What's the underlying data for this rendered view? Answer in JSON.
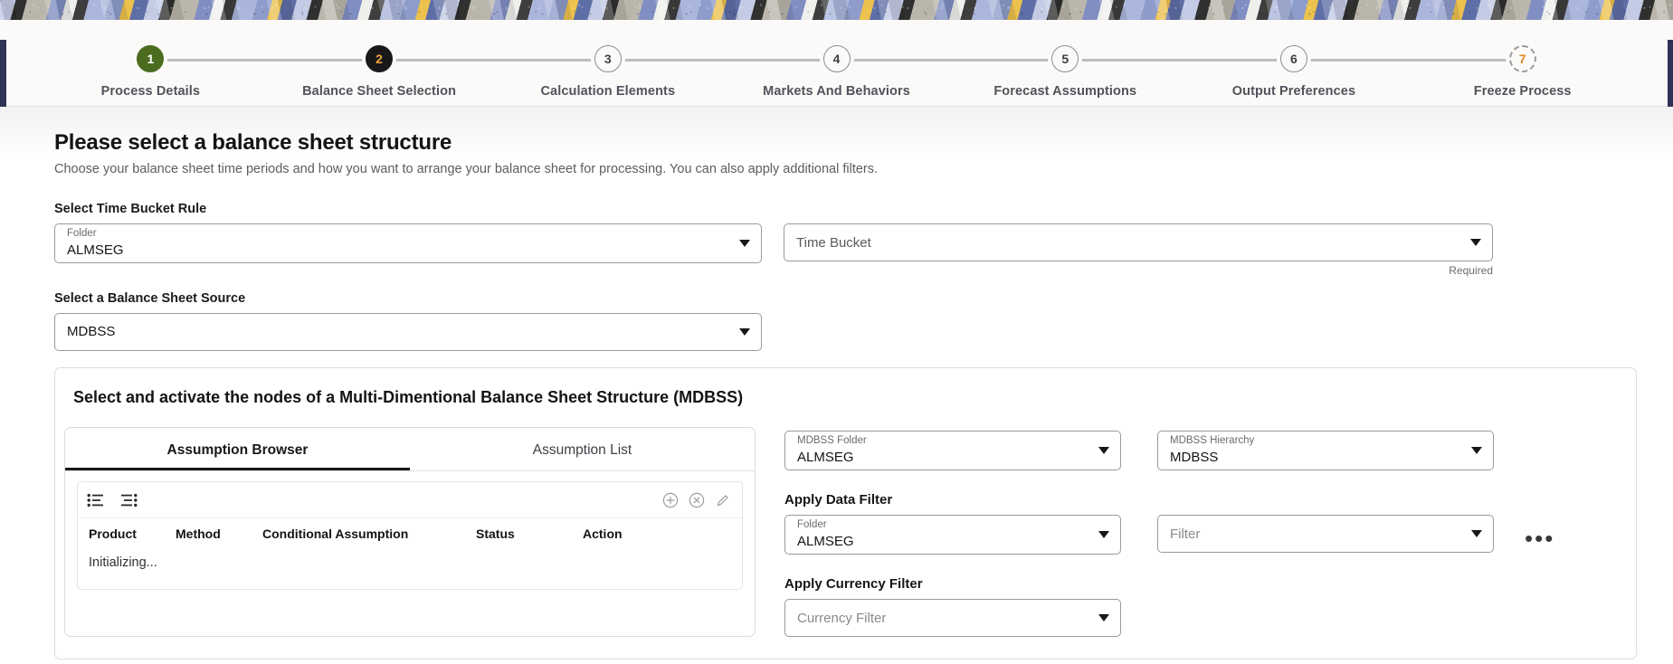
{
  "banner": {
    "name": "decorative-header-image"
  },
  "stepper": {
    "steps": [
      {
        "num": "1",
        "label": "Process Details",
        "state": "done"
      },
      {
        "num": "2",
        "label": "Balance Sheet Selection",
        "state": "active"
      },
      {
        "num": "3",
        "label": "Calculation Elements",
        "state": "todo"
      },
      {
        "num": "4",
        "label": "Markets And Behaviors",
        "state": "todo"
      },
      {
        "num": "5",
        "label": "Forecast Assumptions",
        "state": "todo"
      },
      {
        "num": "6",
        "label": "Output Preferences",
        "state": "todo"
      },
      {
        "num": "7",
        "label": "Freeze Process",
        "state": "pending"
      }
    ]
  },
  "page": {
    "title": "Please select a balance sheet structure",
    "subtitle": "Choose your balance sheet time periods and how you want to arrange your balance sheet for processing. You can also apply additional filters."
  },
  "time_bucket": {
    "section_label": "Select Time Bucket Rule",
    "folder": {
      "label": "Folder",
      "value": "ALMSEG"
    },
    "bucket": {
      "placeholder": "Time Bucket",
      "value": ""
    },
    "required_note": "Required"
  },
  "balance_source": {
    "section_label": "Select a Balance Sheet Source",
    "value": "MDBSS"
  },
  "mdbss": {
    "title": "Select and activate the nodes of a Multi-Dimentional Balance Sheet Structure (MDBSS)",
    "tabs": [
      {
        "label": "Assumption Browser",
        "active": true
      },
      {
        "label": "Assumption List",
        "active": false
      }
    ],
    "toolbar": {
      "list_left_icon": "list-bullets-left-icon",
      "list_right_icon": "list-bullets-right-icon",
      "add_icon": "plus-circle-icon",
      "remove_icon": "close-circle-icon",
      "edit_icon": "pencil-icon"
    },
    "grid": {
      "columns": [
        "Product",
        "Method",
        "Conditional Assumption",
        "Status",
        "Action"
      ],
      "status_text": "Initializing..."
    },
    "folder": {
      "label": "MDBSS Folder",
      "value": "ALMSEG"
    },
    "hierarchy": {
      "label": "MDBSS Hierarchy",
      "value": "MDBSS"
    },
    "data_filter": {
      "block_label": "Apply Data Filter",
      "folder": {
        "label": "Folder",
        "value": "ALMSEG"
      },
      "filter": {
        "placeholder": "Filter",
        "value": ""
      },
      "more_icon": "more-horizontal-icon"
    },
    "currency_filter": {
      "block_label": "Apply Currency Filter",
      "placeholder": "Currency Filter",
      "value": ""
    }
  },
  "colors": {
    "step_done": "#4b6b1f",
    "step_active_bg": "#18181b",
    "step_active_num": "#f0a93b",
    "step_pending_num": "#e2891f",
    "rail": "#2f3355"
  }
}
